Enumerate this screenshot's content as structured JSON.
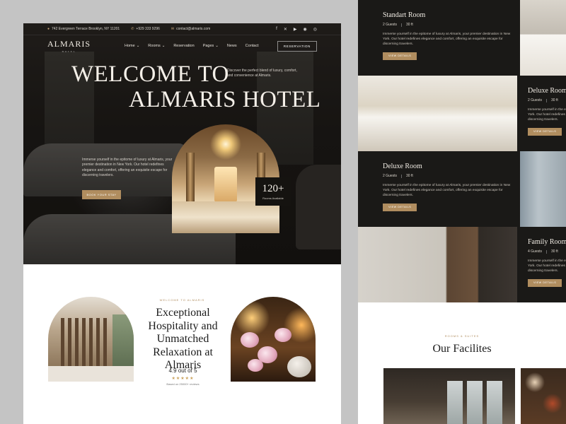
{
  "topbar": {
    "address": "742 Evergreen Terrace Brooklyn, NY 11201",
    "phone": "+929 333 9296",
    "email": "contact@almaris.com",
    "socials": [
      "facebook-icon",
      "x-icon",
      "youtube-icon",
      "pinterest-icon",
      "instagram-icon"
    ]
  },
  "nav": {
    "logo": "ALMARIS",
    "logo_sub": "HOTEL",
    "items": [
      {
        "label": "Home",
        "caret": true
      },
      {
        "label": "Rooms",
        "caret": true
      },
      {
        "label": "Reservation",
        "caret": false
      },
      {
        "label": "Pages",
        "caret": true
      },
      {
        "label": "News",
        "caret": false
      },
      {
        "label": "Contact",
        "caret": false
      }
    ],
    "reservation_button": "RESERVATION"
  },
  "hero": {
    "title_line1": "WELCOME TO",
    "title_line2": "ALMARIS HOTEL",
    "tagline": "Discover the perfect blend of luxury, comfort, and convenience at Almaris.",
    "description": "Immerse yourself in the epitome of luxury at Almaris, your premier destination in New York. Our hotel redefines elegance and comfort, offering an exquisite escape for discerning travelers.",
    "cta": "BOOK YOUR STAY",
    "badge_number": "120+",
    "badge_label": "Rooms Available"
  },
  "about": {
    "tag": "WELCOME TO ALMARIS",
    "title": "Exceptional Hospitality and Unmatched Relaxation at Almaris",
    "score": "4.9 out of 5",
    "stars": "★★★★★",
    "reviews": "Based on 25000+ reviews"
  },
  "rooms": [
    {
      "name": "Standart Room",
      "guests": "2 Guests",
      "size": "30 ft",
      "desc": "Immerse yourself in the epitome of luxury at Almaris, your premier destination in New York. Our hotel redefines elegance and comfort, offering an exquisite escape for discerning travelers.",
      "button": "VIEW DETAILS"
    },
    {
      "name": "Deluxe Room",
      "guests": "2 Guests",
      "size": "30 ft",
      "desc": "Immerse yourself in the epitome of luxury at Almaris, your premier destination in New York. Our hotel redefines elegance and comfort, offering an exquisite escape for discerning travelers.",
      "button": "VIEW DETAILS"
    },
    {
      "name": "Deluxe Room",
      "guests": "2 Guests",
      "size": "30 ft",
      "desc": "Immerse yourself in the epitome of luxury at Almaris, your premier destination in New York. Our hotel redefines elegance and comfort, offering an exquisite escape for discerning travelers.",
      "button": "VIEW DETAILS"
    },
    {
      "name": "Family Room",
      "guests": "4 Guests",
      "size": "30 ft",
      "desc": "Immerse yourself in the epitome of luxury at Almaris, your premier destination in New York. Our hotel redefines elegance and comfort, offering an exquisite escape for discerning travelers.",
      "button": "VIEW DETAILS"
    }
  ],
  "facilities": {
    "tag": "ROOMS & SUITES",
    "title": "Our Facilites"
  },
  "colors": {
    "accent": "#b08d5f",
    "dark": "#1a1917",
    "page_bg": "#c4c4c4"
  }
}
